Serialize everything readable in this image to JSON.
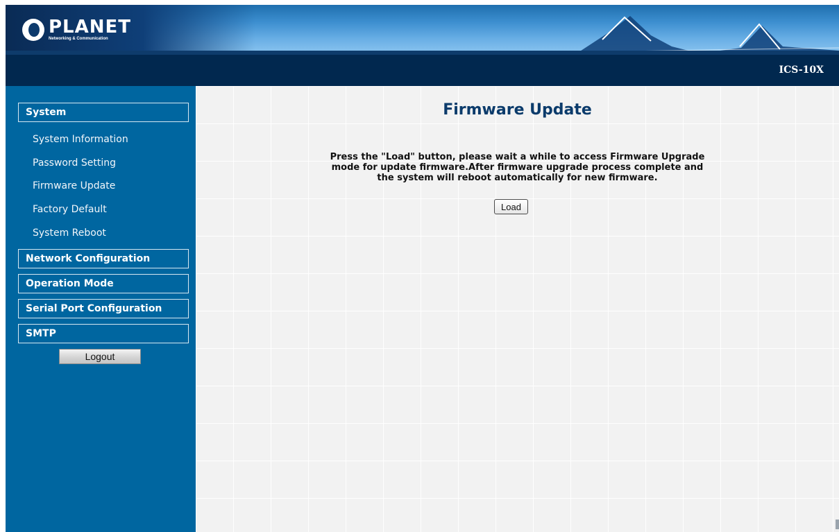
{
  "brand": {
    "name": "PLANET",
    "tagline": "Networking & Communication"
  },
  "device": {
    "model": "ICS-10X"
  },
  "sidebar": {
    "sections": [
      {
        "label": "System",
        "items": [
          "System Information",
          "Password Setting",
          "Firmware Update",
          "Factory Default",
          "System Reboot"
        ]
      },
      {
        "label": "Network Configuration"
      },
      {
        "label": "Operation Mode"
      },
      {
        "label": "Serial Port Configuration"
      },
      {
        "label": "SMTP"
      }
    ],
    "logout_label": "Logout"
  },
  "main": {
    "title": "Firmware Update",
    "notice_lines": [
      "Press the \"Load\" button, please wait a while to access Firmware Upgrade",
      "mode for update firmware.After firmware upgrade process complete and",
      "the system will reboot automatically for new firmware."
    ],
    "load_label": "Load"
  },
  "colors": {
    "sidebar_bg": "#0066a0",
    "model_bar_bg": "#01284f",
    "title_color": "#0b3b6b"
  }
}
